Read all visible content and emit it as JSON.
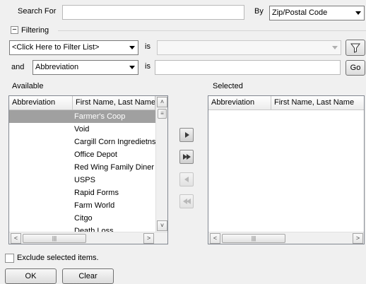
{
  "search": {
    "label": "Search For",
    "value": "",
    "by_label": "By",
    "by_value": "Zip/Postal Code"
  },
  "filtering": {
    "toggle_symbol": "−",
    "title": "Filtering",
    "row1": {
      "field": "<Click Here to Filter List>",
      "op": "is",
      "value": ""
    },
    "row2": {
      "conj": "and",
      "field": "Abbreviation",
      "op": "is",
      "value": "",
      "go_label": "Go"
    }
  },
  "available": {
    "title": "Available",
    "columns": [
      "Abbreviation",
      "First Name, Last Name"
    ],
    "rows": [
      {
        "abbr": "",
        "name": "Farmer's Coop"
      },
      {
        "abbr": "",
        "name": "Void"
      },
      {
        "abbr": "",
        "name": "Cargill Corn Ingredietns"
      },
      {
        "abbr": "",
        "name": "Office Depot"
      },
      {
        "abbr": "",
        "name": "Red Wing Family Diner"
      },
      {
        "abbr": "",
        "name": "USPS"
      },
      {
        "abbr": "",
        "name": "Rapid Forms"
      },
      {
        "abbr": "",
        "name": "Farm World"
      },
      {
        "abbr": "",
        "name": "Citgo"
      },
      {
        "abbr": "",
        "name": "Death Loss"
      }
    ],
    "selected_row": 0
  },
  "selected": {
    "title": "Selected",
    "columns": [
      "Abbreviation",
      "First Name, Last Name"
    ],
    "rows": []
  },
  "move_buttons": {
    "add_icon": "single-right-arrow",
    "add_all_icon": "double-right-arrow",
    "remove_icon": "single-left-arrow",
    "remove_all_icon": "double-left-arrow"
  },
  "exclude_label": "Exclude selected items.",
  "ok_label": "OK",
  "clear_label": "Clear",
  "colors": {
    "selection": "#a0a0a0",
    "background": "#f0f0f0"
  }
}
